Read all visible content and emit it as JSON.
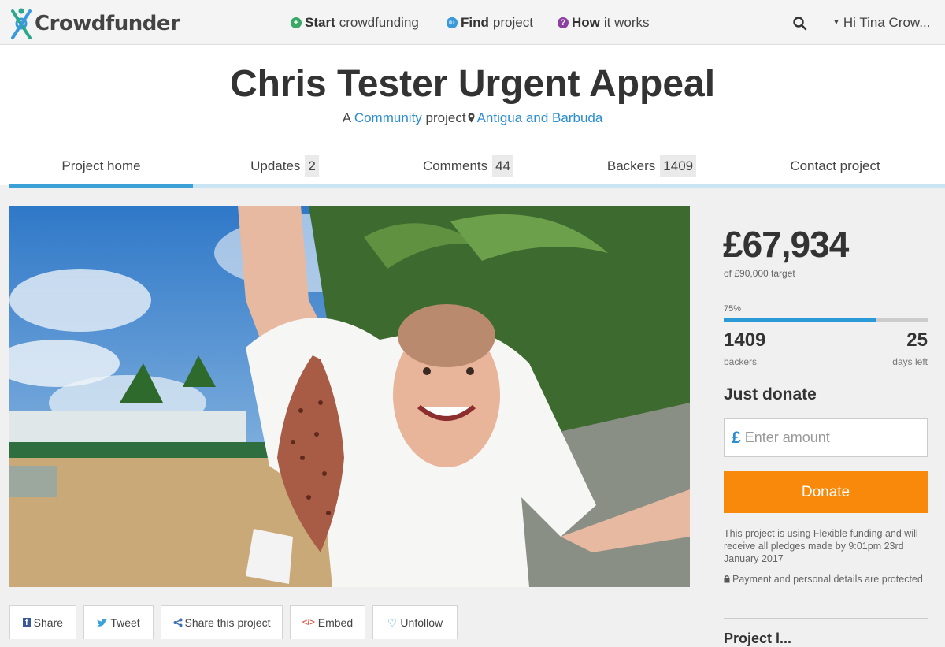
{
  "header": {
    "logo_text": "Crowdfunder",
    "nav": [
      {
        "bold": "Start",
        "rest": "crowdfunding",
        "icon": "plus-circle-icon",
        "icon_color": "#3aa867"
      },
      {
        "bold": "Find",
        "rest": "project",
        "icon": "globe-icon",
        "icon_color": "#3a9ad9"
      },
      {
        "bold": "How",
        "rest": "it works",
        "icon": "question-circle-icon",
        "icon_color": "#8c3fa3"
      }
    ],
    "user_label": "Hi Tina Crow..."
  },
  "project": {
    "title": "Chris Tester Urgent Appeal",
    "subtitle_prefix": "A",
    "category": "Community",
    "subtitle_mid": "project",
    "location": "Antigua and Barbuda"
  },
  "tabs": [
    {
      "label": "Project home",
      "count": null,
      "active": true
    },
    {
      "label": "Updates",
      "count": "2"
    },
    {
      "label": "Comments",
      "count": "44"
    },
    {
      "label": "Backers",
      "count": "1409"
    },
    {
      "label": "Contact project",
      "count": null
    }
  ],
  "share": [
    {
      "label": "Share",
      "icon": "facebook-icon"
    },
    {
      "label": "Tweet",
      "icon": "twitter-icon"
    },
    {
      "label": "Share this project",
      "icon": "share-icon"
    },
    {
      "label": "Embed",
      "icon": "code-icon"
    },
    {
      "label": "Unfollow",
      "icon": "heart-icon"
    }
  ],
  "funding": {
    "amount": "£67,934",
    "target_text": "of £90,000 target",
    "percent_label": "75%",
    "percent": 75,
    "backers_count": "1409",
    "backers_label": "backers",
    "days_count": "25",
    "days_label": "days left"
  },
  "donate": {
    "heading": "Just donate",
    "currency": "£",
    "placeholder": "Enter amount",
    "button_label": "Donate",
    "note": "This project is using Flexible funding and will receive all pledges made by 9:01pm 23rd January 2017",
    "secure_note": "Payment and personal details are protected",
    "next_heading": "Project l..."
  },
  "colors": {
    "accent": "#2a9ad6",
    "donate": "#f8890b",
    "link": "#2a8dd0"
  }
}
